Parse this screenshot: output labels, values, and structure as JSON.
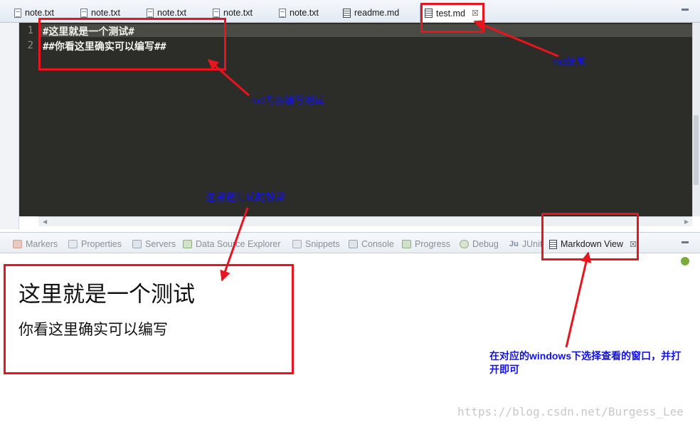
{
  "editor": {
    "tabs": [
      {
        "label": "note.txt",
        "icon": "text-file-icon"
      },
      {
        "label": "note.txt",
        "icon": "text-file-icon"
      },
      {
        "label": "note.txt",
        "icon": "text-file-icon"
      },
      {
        "label": "note.txt",
        "icon": "text-file-icon"
      },
      {
        "label": "note.txt",
        "icon": "text-file-icon"
      },
      {
        "label": "readme.md",
        "icon": "markdown-file-icon"
      },
      {
        "label": "test.md",
        "icon": "markdown-file-icon",
        "active": true,
        "close": "☒"
      }
    ],
    "line_numbers": [
      "1",
      "2"
    ],
    "lines": [
      "#这里就是一个测试#",
      "##你看这里确实可以编写##"
    ],
    "background": "#2c2c28"
  },
  "views": {
    "tabs": [
      {
        "label": "Markers",
        "icon": "markers-icon"
      },
      {
        "label": "Properties",
        "icon": "properties-icon"
      },
      {
        "label": "Servers",
        "icon": "servers-icon"
      },
      {
        "label": "Data Source Explorer",
        "icon": "data-source-icon"
      },
      {
        "label": "Snippets",
        "icon": "snippets-icon"
      },
      {
        "label": "Console",
        "icon": "console-icon"
      },
      {
        "label": "Progress",
        "icon": "progress-icon"
      },
      {
        "label": "Debug",
        "icon": "debug-icon"
      },
      {
        "label": "JUnit",
        "icon": "junit-icon"
      },
      {
        "label": "Markdown View",
        "icon": "markdown-view-icon",
        "active": true,
        "close": "☒"
      }
    ]
  },
  "markdown_view": {
    "heading1": "这里就是一个测试",
    "heading2": "你看这里确实可以编写"
  },
  "annotations": {
    "md_suffix": "md结尾",
    "md_content": "md内容编写测试",
    "effect": "这里是测试的效果",
    "open_window": "在对应的windows下选择查看的窗口，并打开即可"
  },
  "watermark": "https://blog.csdn.net/Burgess_Lee",
  "colors": {
    "annotation_red": "#e8141e",
    "annotation_blue": "#1212e6"
  }
}
